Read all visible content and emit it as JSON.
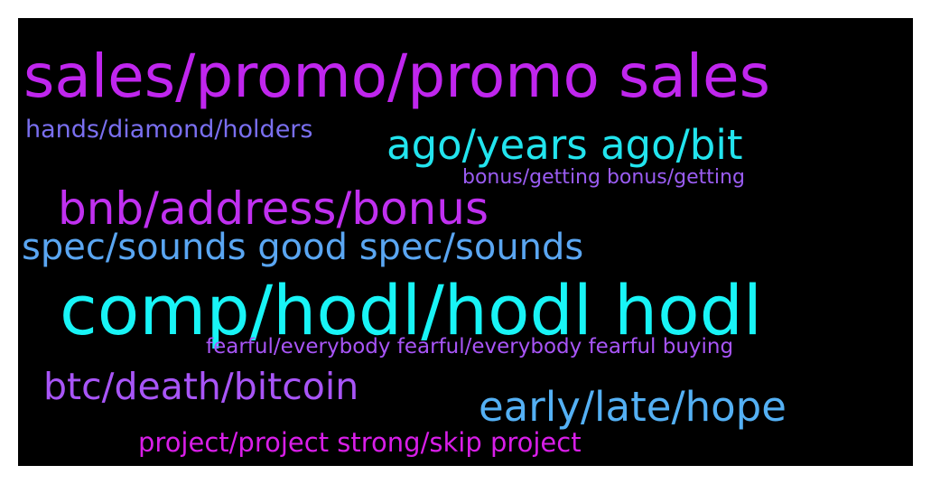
{
  "wordcloud": {
    "background": "#000000",
    "words": [
      {
        "text": "sales/promo/promo sales",
        "color": "#c026ee"
      },
      {
        "text": "hands/diamond/holders",
        "color": "#7a6ff0"
      },
      {
        "text": "ago/years ago/bit",
        "color": "#22e4ee"
      },
      {
        "text": "bonus/getting bonus/getting",
        "color": "#9a5cf2"
      },
      {
        "text": "bnb/address/bonus",
        "color": "#c030f0"
      },
      {
        "text": "spec/sounds good spec/sounds",
        "color": "#5aa6f2"
      },
      {
        "text": "comp/hodl/hodl hodl",
        "color": "#18f4f6"
      },
      {
        "text": "fearful/everybody fearful/everybody fearful buying",
        "color": "#a855f7"
      },
      {
        "text": "btc/death/bitcoin",
        "color": "#a855f7"
      },
      {
        "text": "early/late/hope",
        "color": "#54b0f4"
      },
      {
        "text": "project/project strong/skip project",
        "color": "#d81ee8"
      }
    ]
  }
}
